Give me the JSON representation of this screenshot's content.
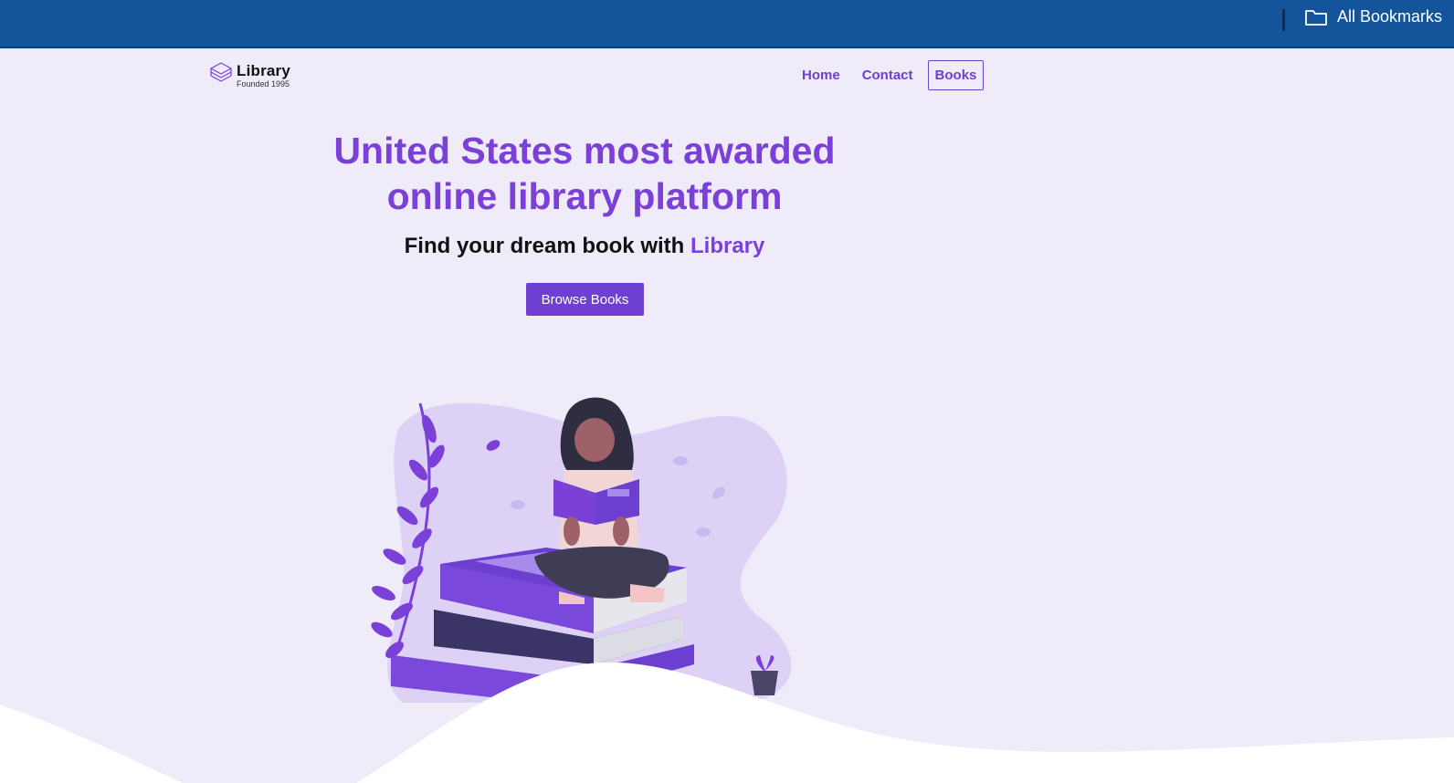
{
  "browser": {
    "bookmarks_folder_label": "All Bookmarks",
    "bar_color": "#13549a"
  },
  "site": {
    "logo": {
      "name": "Library",
      "tagline": "Founded 1995"
    },
    "nav": {
      "items": [
        {
          "label": "Home",
          "active": false
        },
        {
          "label": "Contact",
          "active": false
        },
        {
          "label": "Books",
          "active": true
        }
      ]
    },
    "hero": {
      "title": "United States most awarded online library platform",
      "subtitle_prefix": "Find your dream book with ",
      "subtitle_brand": "Library",
      "cta_label": "Browse Books"
    },
    "colors": {
      "accent": "#7a40d8",
      "button": "#6f3fd1",
      "background": "#efebf9"
    }
  }
}
